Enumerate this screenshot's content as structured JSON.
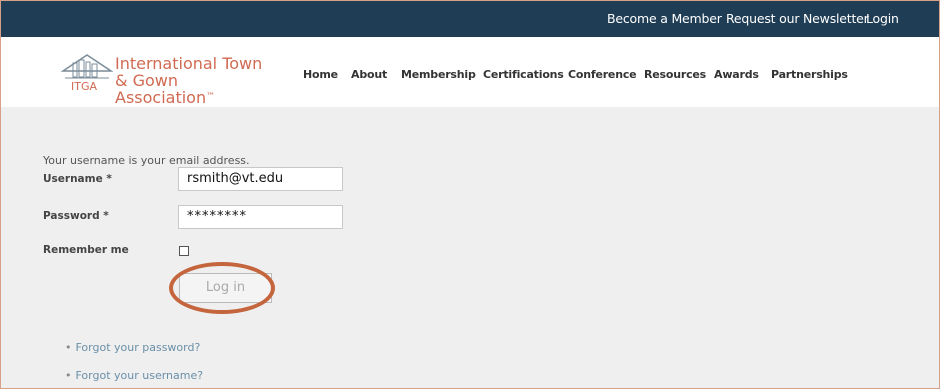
{
  "topbar": {
    "become_member": "Become a Member",
    "newsletter": "Request our Newsletter",
    "login": "Login"
  },
  "logo": {
    "line1": "International Town",
    "line2": "& Gown Association",
    "tm": "™",
    "abbr": "ITGA"
  },
  "nav": {
    "items": [
      "Home",
      "About",
      "Membership",
      "Certifications",
      "Conference",
      "Resources",
      "Awards",
      "Partnerships"
    ]
  },
  "form": {
    "hint": "Your username is your email address.",
    "username_label": "Username *",
    "username_value": "rsmith@vt.edu",
    "password_label": "Password *",
    "password_value": "********",
    "remember_label": "Remember me",
    "login_button": "Log in"
  },
  "links": {
    "forgot_password": "Forgot your password?",
    "forgot_username": "Forgot your username?"
  },
  "colors": {
    "topbar": "#1f3d55",
    "logo_text": "#d06a52",
    "highlight_circle": "#c4653d",
    "link": "#6a8fa8"
  }
}
